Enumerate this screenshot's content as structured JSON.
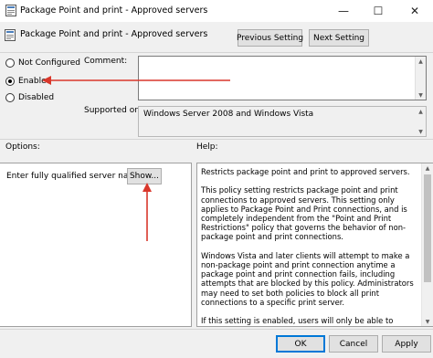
{
  "window": {
    "title": "Package Point and print - Approved servers",
    "minimize_glyph": "—",
    "maximize_glyph": "☐",
    "close_glyph": "✕"
  },
  "header": {
    "policy_name": "Package Point and print - Approved servers",
    "previous_setting_label": "Previous Setting",
    "next_setting_label": "Next Setting"
  },
  "state": {
    "options": [
      {
        "label": "Not Configured",
        "checked": false
      },
      {
        "label": "Enabled",
        "checked": true
      },
      {
        "label": "Disabled",
        "checked": false
      }
    ]
  },
  "comment": {
    "label": "Comment:",
    "value": ""
  },
  "supported_on": {
    "label": "Supported on:",
    "value": "Windows Server 2008 and Windows Vista"
  },
  "options_panel": {
    "label": "Options:",
    "server_names_label": "Enter fully qualified server names",
    "show_button_label": "Show..."
  },
  "help_panel": {
    "label": "Help:",
    "paragraphs": [
      "Restricts package point and print to approved servers.",
      "This policy setting restricts package point and print connections to approved servers. This setting only applies to Package Point and Print connections, and is completely independent from the \"Point and Print Restrictions\" policy that governs the behavior of non-package point and print connections.",
      "Windows Vista and later clients will attempt to make a non-package point and print connection anytime a package point and print connection fails, including attempts that are blocked by this policy. Administrators may need to set both policies to block all print connections to a specific print server.",
      "If this setting is enabled, users will only be able to package point and print to print servers approved by the network administrator. When using package point and print, client computers will check"
    ]
  },
  "footer": {
    "ok_label": "OK",
    "cancel_label": "Cancel",
    "apply_label": "Apply"
  },
  "colors": {
    "annotation_arrow": "#d9372b",
    "default_button_border": "#0078d7",
    "window_background": "#f0f0f0"
  },
  "icons": {
    "window_icon": "policy-settings-icon",
    "header_icon": "policy-settings-icon"
  }
}
